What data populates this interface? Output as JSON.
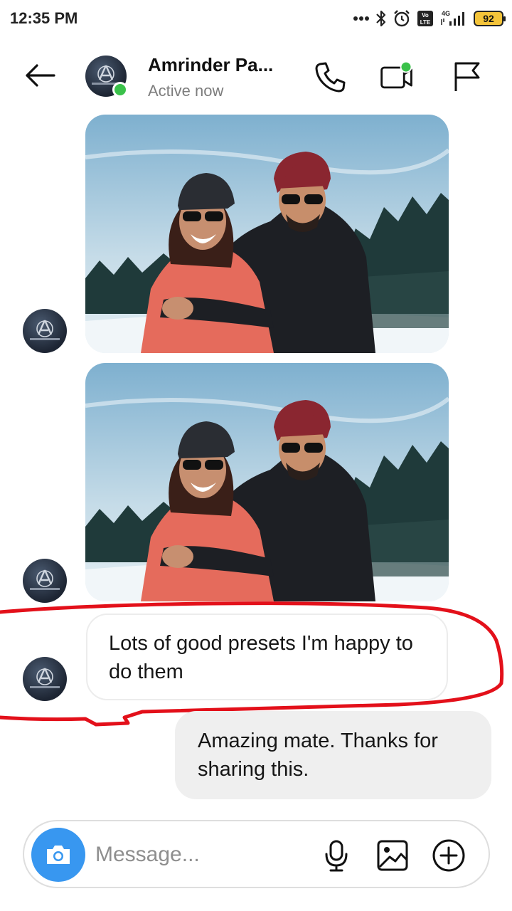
{
  "status_bar": {
    "time": "12:35 PM",
    "icons": [
      "more-dots-icon",
      "bluetooth-icon",
      "alarm-icon",
      "volte-icon",
      "signal-4g-icon"
    ],
    "volte_label": "Vo LTE",
    "network_label": "4G",
    "battery_level": "92"
  },
  "header": {
    "contact_name": "Amrinder Pa...",
    "status": "Active now",
    "online": true,
    "actions": [
      "back-arrow-icon",
      "phone-icon",
      "video-camera-icon",
      "flag-icon"
    ]
  },
  "thread": {
    "messages": [
      {
        "from": "contact",
        "type": "photo"
      },
      {
        "from": "contact",
        "type": "photo"
      },
      {
        "from": "contact",
        "type": "text",
        "text": "Lots of good presets I'm happy to do them"
      },
      {
        "from": "me",
        "type": "text",
        "text": "Amazing mate. Thanks for sharing this."
      }
    ]
  },
  "composer": {
    "placeholder": "Message...",
    "icons": [
      "camera-icon",
      "microphone-icon",
      "gallery-icon",
      "add-icon"
    ]
  },
  "colors": {
    "accent": "#3897f0",
    "online": "#3ac14a",
    "battery": "#f4c43a",
    "annotation": "#e3101a",
    "outgoing_bubble": "#efefef"
  }
}
